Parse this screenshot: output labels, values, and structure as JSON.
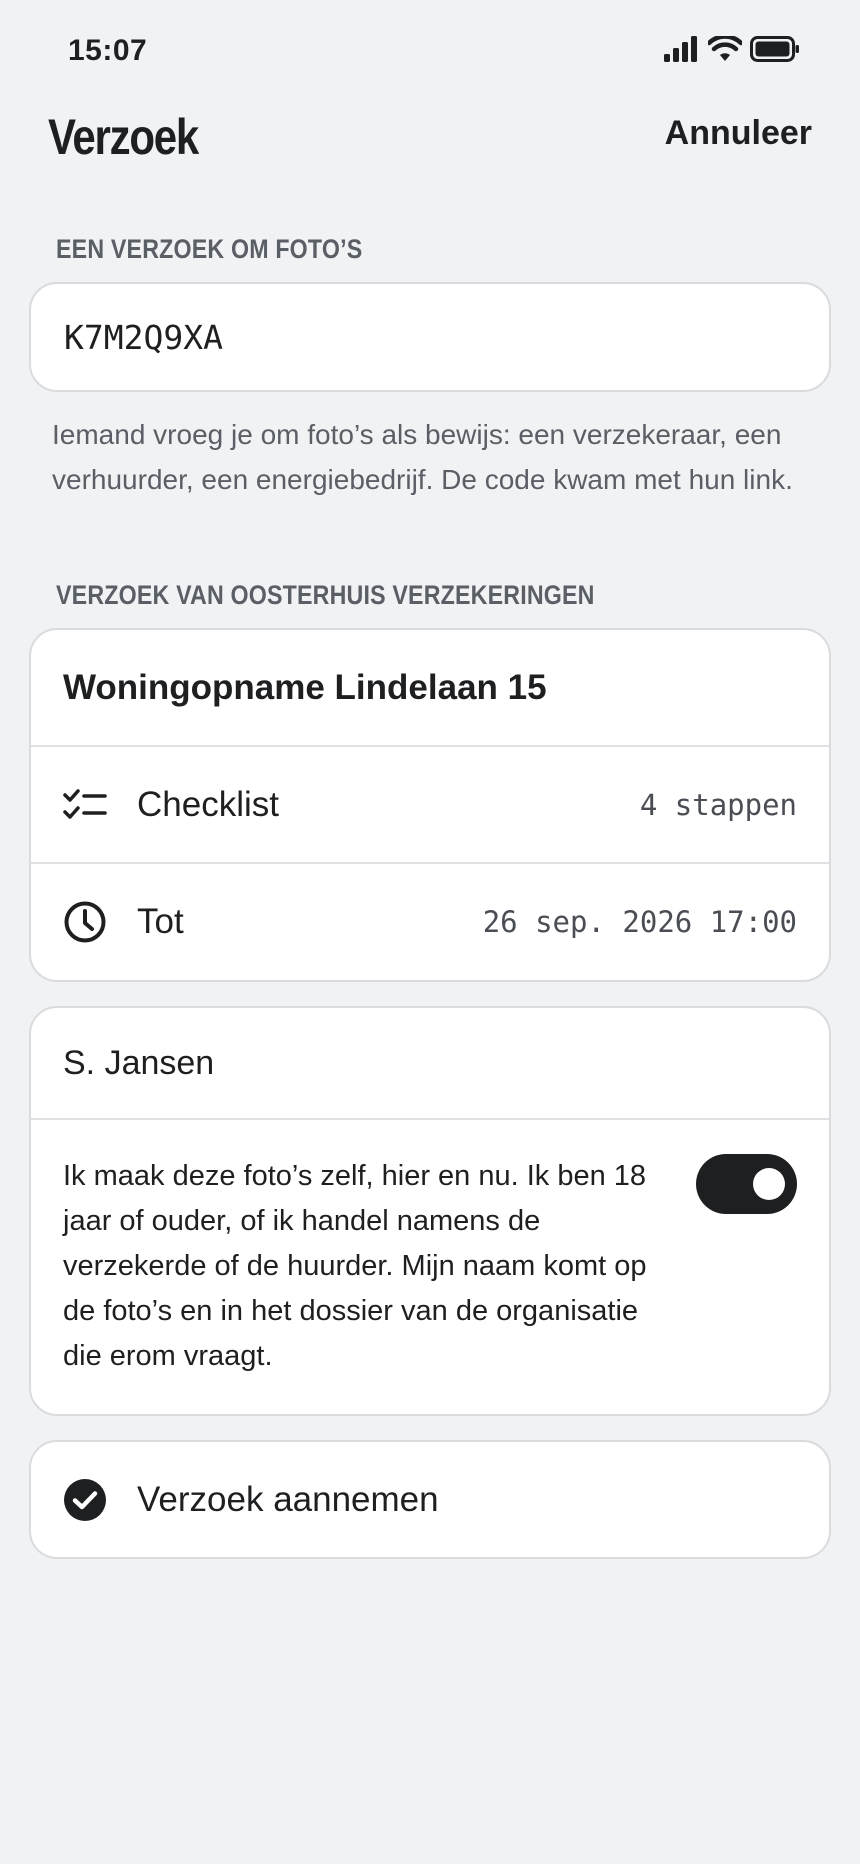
{
  "status_bar": {
    "time": "15:07",
    "icons": [
      "signal-icon",
      "wifi-icon",
      "battery-icon"
    ]
  },
  "header": {
    "title": "Verzoek",
    "cancel_label": "Annuleer"
  },
  "photo_request": {
    "section_label": "EEN VERZOEK OM FOTO’S",
    "code_value": "K7M2Q9XA",
    "help_text": "Iemand vroeg je om foto’s als bewijs: een verzekeraar, een verhuurder, een energiebedrijf. De code kwam met hun link."
  },
  "request": {
    "section_label": "VERZOEK VAN OOSTERHUIS VERZEKERINGEN",
    "title": "Woningopname Lindelaan 15",
    "checklist_label": "Checklist",
    "checklist_value": "4 stappen",
    "deadline_label": "Tot",
    "deadline_value": "26 sep. 2026 17:00"
  },
  "consent": {
    "name": "S. Jansen",
    "text": "Ik maak deze foto’s zelf, hier en nu. Ik ben 18 jaar of ouder, of ik handel namens de verzekerde of de huurder. Mijn naam komt op de foto’s en in het dossier van de organisatie die erom vraagt.",
    "toggle_on": true
  },
  "accept": {
    "label": "Verzoek aannemen"
  },
  "colors": {
    "background": "#f1f2f4",
    "text": "#1d1f21",
    "muted": "#5a5f66",
    "card": "#ffffff",
    "border": "#d9dbde"
  }
}
